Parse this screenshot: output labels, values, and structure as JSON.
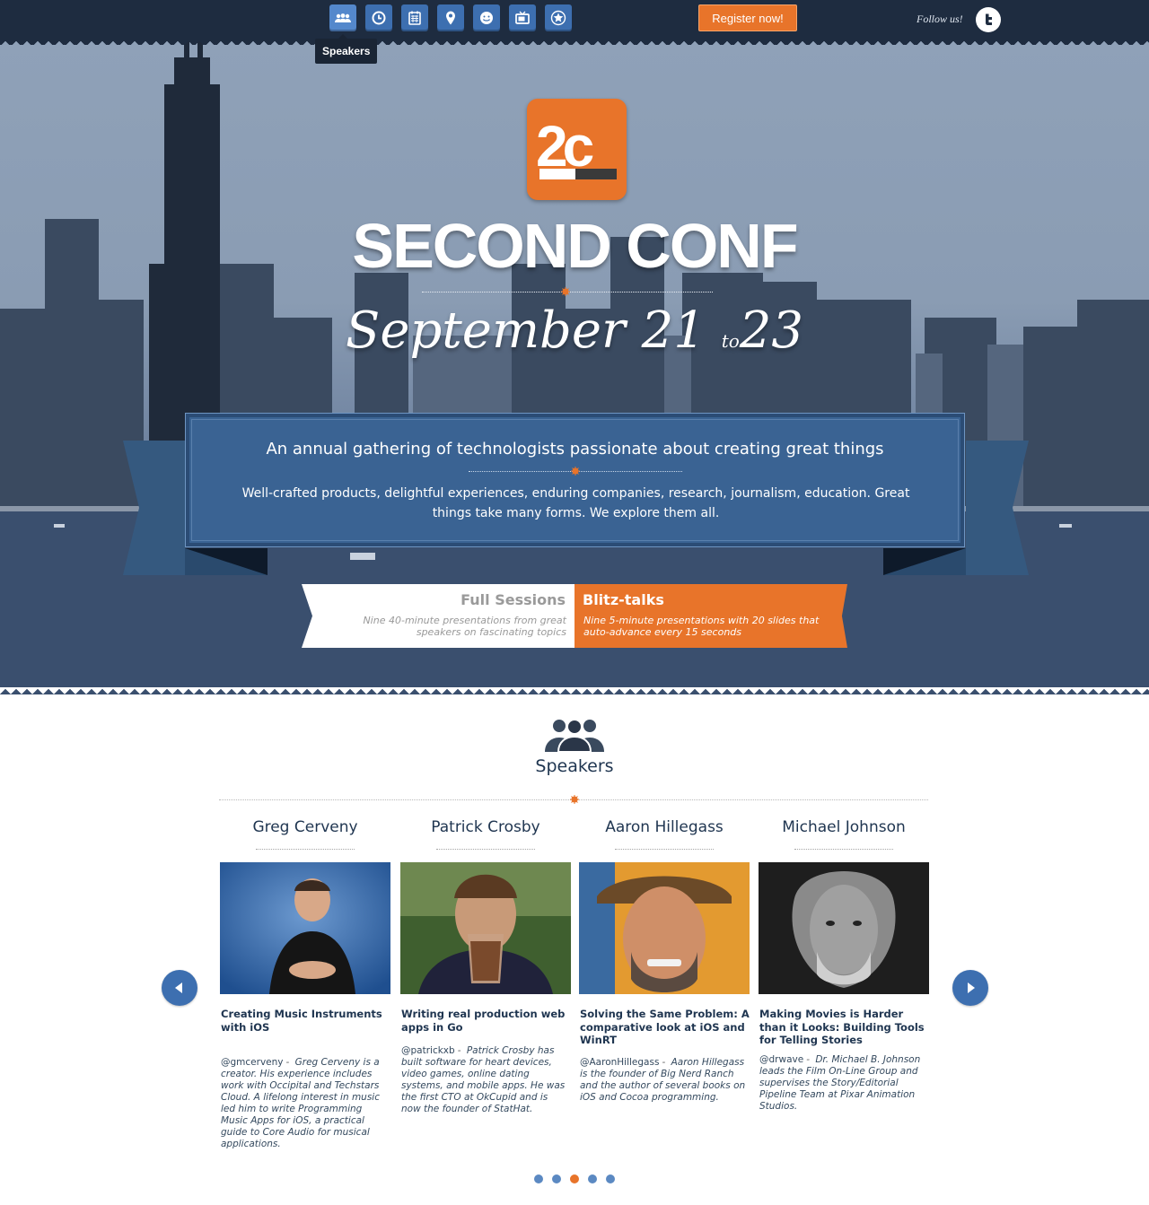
{
  "nav": {
    "icons": [
      "speakers-icon",
      "clock-icon",
      "calendar-icon",
      "map-pin-icon",
      "smiley-icon",
      "tv-icon",
      "star-badge-icon"
    ],
    "tooltip": "Speakers",
    "register_label": "Register now!",
    "follow_label": "Follow us!",
    "twitter_icon": "twitter-icon"
  },
  "hero": {
    "logo_text": "2c",
    "title": "SECOND CONF",
    "date_start": "September 21",
    "date_to": "to",
    "date_end": "23",
    "tagline": "An annual gathering of technologists passionate about creating great things",
    "description": "Well-crafted products, delightful experiences, enduring companies, research, journalism, education. Great things take many forms. We explore them all.",
    "sessions": [
      {
        "title": "Full Sessions",
        "text": "Nine 40-minute presentations from great speakers on fascinating topics"
      },
      {
        "title": "Blitz-talks",
        "text": "Nine 5-minute presentations with 20 slides that auto-advance every 15 seconds"
      }
    ]
  },
  "speakers_section": {
    "heading": "Speakers",
    "speakers": [
      {
        "name": "Greg Cerveny",
        "talk": "Creating Music Instruments with iOS",
        "handle": "@gmcerveny",
        "bio": "Greg Cerveny is a creator. His experience includes work with Occipital and Techstars Cloud. A lifelong interest in music led him to write Programming Music Apps for iOS, a practical guide to Core Audio for musical applications."
      },
      {
        "name": "Patrick Crosby",
        "talk": "Writing real production web apps in Go",
        "handle": "@patrickxb",
        "bio": "Patrick Crosby has built software for heart devices, video games, online dating systems, and mobile apps. He was the first CTO at OkCupid and is now the founder of StatHat."
      },
      {
        "name": "Aaron Hillegass",
        "talk": "Solving the Same Problem: A comparative look at iOS and WinRT",
        "handle": "@AaronHillegass",
        "bio": "Aaron Hillegass is the founder of Big Nerd Ranch and the author of several books on iOS and Cocoa programming."
      },
      {
        "name": "Michael Johnson",
        "talk": "Making Movies is Harder than it Looks: Building Tools for Telling Stories",
        "handle": "@drwave",
        "bio": "Dr. Michael B. Johnson leads the Film On-Line Group and supervises the Story/Editorial Pipeline Team at Pixar Animation Studios."
      }
    ],
    "separator": "-",
    "pagination": {
      "pages": 5,
      "active": 3
    }
  },
  "colors": {
    "accent": "#e8742a",
    "navy": "#1e2c40",
    "blue": "#3d6fb0",
    "banner": "#3a6393"
  }
}
